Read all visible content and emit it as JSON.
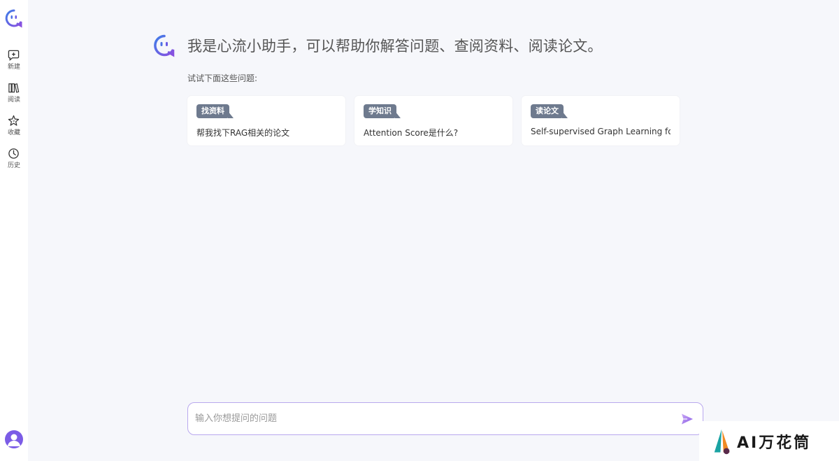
{
  "sidebar": {
    "items": [
      {
        "label": "新建",
        "icon": "new-chat-icon"
      },
      {
        "label": "阅读",
        "icon": "books-icon"
      },
      {
        "label": "收藏",
        "icon": "star-icon"
      },
      {
        "label": "历史",
        "icon": "clock-icon"
      }
    ]
  },
  "hero": {
    "title": "我是心流小助手，可以帮助你解答问题、查阅资料、阅读论文。"
  },
  "suggestions": {
    "label": "试试下面这些问题:",
    "cards": [
      {
        "tag": "找资料",
        "text": "帮我找下RAG相关的论文"
      },
      {
        "tag": "学知识",
        "text": "Attention Score是什么?"
      },
      {
        "tag": "读论文",
        "text": "Self-supervised Graph Learning for..."
      }
    ]
  },
  "input": {
    "placeholder": "输入你想提问的问题",
    "value": ""
  },
  "watermark": {
    "text": "AI万花筒"
  },
  "colors": {
    "accent": "#7b5ce6",
    "tag_bg": "#6e7a8e",
    "page_bg": "#f6f7fb"
  }
}
